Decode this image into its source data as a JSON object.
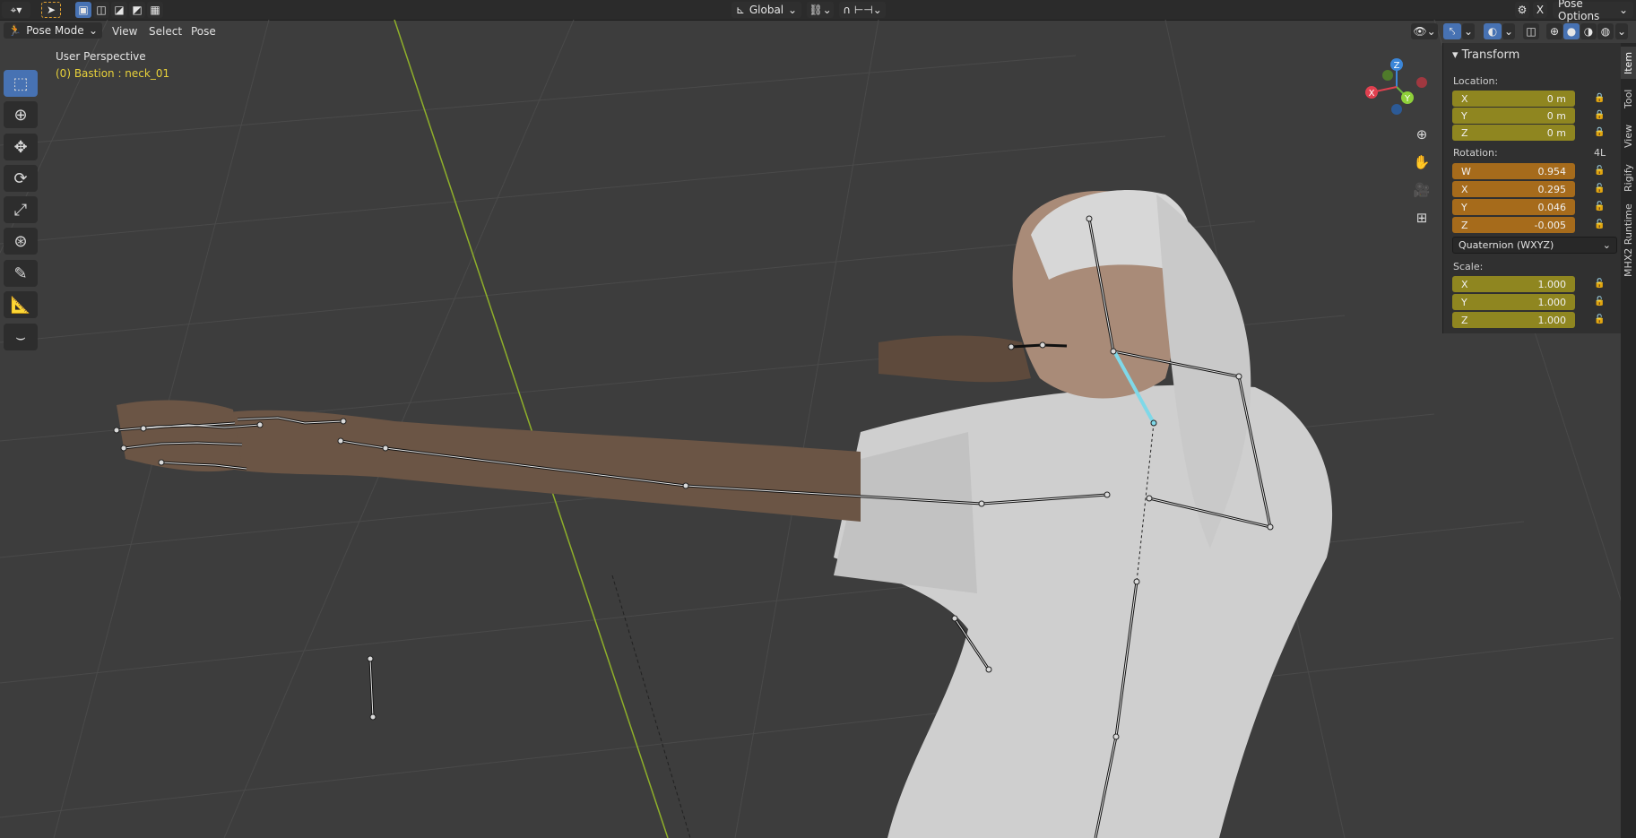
{
  "topbar": {
    "transform_orientation": "Global",
    "pose_options": "Pose Options",
    "close_x": "X"
  },
  "header": {
    "mode": "Pose Mode",
    "menus": [
      "View",
      "Select",
      "Pose"
    ]
  },
  "viewport": {
    "perspective": "User Perspective",
    "object_info": "(0) Bastion : neck_01"
  },
  "gizmo": {
    "z": "Z",
    "y": "Y",
    "x": "X"
  },
  "npanel": {
    "title": "Transform",
    "location_label": "Location:",
    "location": [
      {
        "axis": "X",
        "value": "0 m"
      },
      {
        "axis": "Y",
        "value": "0 m"
      },
      {
        "axis": "Z",
        "value": "0 m"
      }
    ],
    "rotation_label": "Rotation:",
    "rotation_lock_mode": "4L",
    "rotation": [
      {
        "axis": "W",
        "value": "0.954"
      },
      {
        "axis": "X",
        "value": "0.295"
      },
      {
        "axis": "Y",
        "value": "0.046"
      },
      {
        "axis": "Z",
        "value": "-0.005"
      }
    ],
    "rotation_mode": "Quaternion (WXYZ)",
    "scale_label": "Scale:",
    "scale": [
      {
        "axis": "X",
        "value": "1.000"
      },
      {
        "axis": "Y",
        "value": "1.000"
      },
      {
        "axis": "Z",
        "value": "1.000"
      }
    ]
  },
  "tabs": [
    "Item",
    "Tool",
    "View",
    "Rigify",
    "MHX2 Runtime"
  ],
  "colors": {
    "grid_line": "#8fb02a",
    "selected_bone": "#7fd8e8",
    "text_yellow": "#e8d13a",
    "accent": "#4772b3"
  }
}
